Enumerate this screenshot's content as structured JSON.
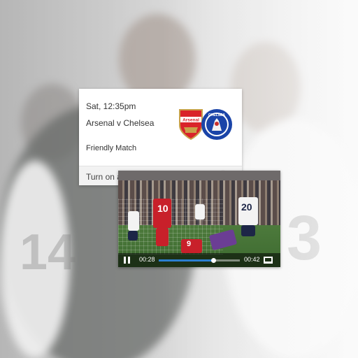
{
  "card": {
    "datetime": "Sat, 12:35pm",
    "teams": "Arsenal v Chelsea",
    "match_type": "Friendly Match",
    "notify_label": "Turn on all match notifications",
    "notify_enabled": false,
    "home_crest_text": "Arsenal",
    "away_crest_text": "CHELSEA"
  },
  "video": {
    "current_time": "00:28",
    "duration": "00:42",
    "progress": 0.67,
    "jersey_numbers": [
      "10",
      "9",
      "20"
    ]
  },
  "background": {
    "jersey_numbers": [
      "14",
      "3"
    ]
  },
  "colors": {
    "accent": "#2b7fd1",
    "arsenal_red": "#d9232a",
    "chelsea_blue": "#1a44a8"
  },
  "icons": {
    "play_pause": "pause-icon",
    "fullscreen": "fullscreen-icon",
    "toggle": "toggle-off"
  }
}
